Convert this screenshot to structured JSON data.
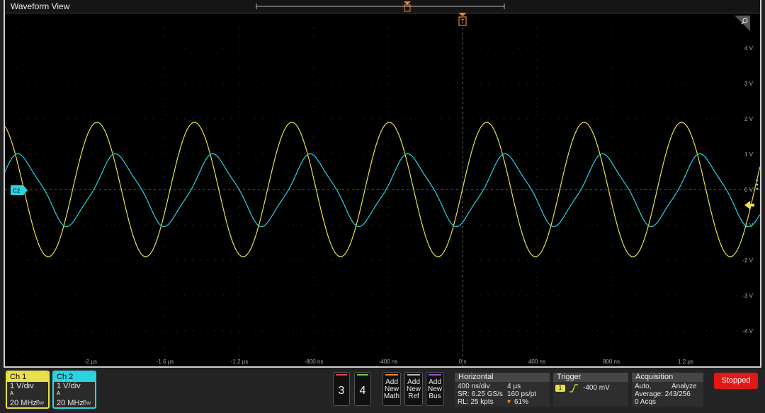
{
  "window": {
    "title": "Waveform View"
  },
  "colors": {
    "ch1": "#e8e04a",
    "ch2": "#2ad3e0",
    "trigger_marker": "#f08a2a",
    "stopped": "#e01818"
  },
  "plot": {
    "x_tick_labels": [
      "-2 µs",
      "-1.6 µs",
      "-1.2 µs",
      "-800 ns",
      "-400 ns",
      "0 s",
      "400 ns",
      "800 ns",
      "1.2 µs"
    ],
    "y_tick_labels": [
      "4 V",
      "3 V",
      "2 V",
      "1 V",
      "0 V",
      "-1 V",
      "-2 V",
      "-3 V",
      "-4 V"
    ],
    "trigger_marker_label": "T",
    "ch2_offset_marker_label": "C2",
    "traces": [
      {
        "name": "Ch 1",
        "color": "#e8e04a",
        "amplitude_v": 1.9,
        "period_ns": 524
      },
      {
        "name": "Ch 2",
        "color": "#2ad3e0",
        "amplitude_v": 1.0,
        "period_ns": 524
      }
    ]
  },
  "channels": [
    {
      "label": "Ch 1",
      "scale": "1 V/div",
      "bandwidth": "20 MHz"
    },
    {
      "label": "Ch 2",
      "scale": "1 V/div",
      "bandwidth": "20 MHz"
    }
  ],
  "channel_buttons": [
    "3",
    "4"
  ],
  "add_buttons": {
    "math": [
      "Add",
      "New",
      "Math"
    ],
    "ref": [
      "Add",
      "New",
      "Ref"
    ],
    "bus": [
      "Add",
      "New",
      "Bus"
    ]
  },
  "horizontal": {
    "title": "Horizontal",
    "scale": "400 ns/div",
    "duration": "4 µs",
    "sample_rate": "SR: 6.25 GS/s",
    "resolution": "160 ps/pt",
    "record_length": "RL: 25 kpts",
    "position": "61%"
  },
  "trigger": {
    "title": "Trigger",
    "source": "1",
    "level": "-400 mV"
  },
  "acquisition": {
    "title": "Acquisition",
    "mode": "Auto,",
    "analyze": "Analyze",
    "average": "Average: 243/256",
    "acqs": "0 Acqs"
  },
  "run_state": "Stopped"
}
